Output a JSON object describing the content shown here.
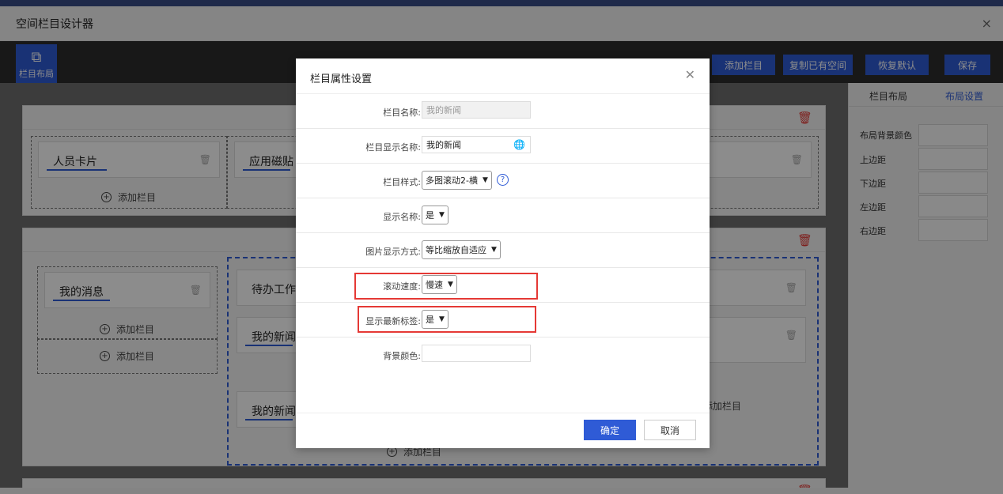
{
  "window": {
    "title": "空间栏目设计器",
    "close_icon": "×"
  },
  "toolbar": {
    "layout_button_label": "栏目布局",
    "add_column_label": "添加栏目",
    "copy_space_label": "复制已有空间",
    "restore_default_label": "恢复默认",
    "save_label": "保存"
  },
  "canvas": {
    "cards": {
      "personnel_card": "人员卡片",
      "app_tiles": "应用磁贴",
      "my_messages": "我的消息",
      "todo_work": "待办工作",
      "my_news_1": "我的新闻",
      "my_news_2": "我的新闻"
    },
    "add_column_text": "添加栏目"
  },
  "right_panel": {
    "tabs": [
      "栏目布局",
      "布局设置"
    ],
    "fields": [
      "布局背景颜色",
      "上边距",
      "下边距",
      "左边距",
      "右边距"
    ]
  },
  "modal": {
    "title": "栏目属性设置",
    "rows": [
      {
        "label": "栏目名称:",
        "value": "我的新闻",
        "kind": "input-disabled"
      },
      {
        "label": "栏目显示名称:",
        "value": "我的新闻",
        "kind": "input-globe"
      },
      {
        "label": "栏目样式:",
        "value": "多图滚动2-横",
        "kind": "select-help"
      },
      {
        "label": "显示名称:",
        "value": "是",
        "kind": "select"
      },
      {
        "label": "图片显示方式:",
        "value": "等比缩放自适应",
        "kind": "select"
      },
      {
        "label": "滚动速度:",
        "value": "慢速",
        "kind": "select"
      },
      {
        "label": "显示最新标签:",
        "value": "是",
        "kind": "select"
      },
      {
        "label": "背景颜色:",
        "value": "",
        "kind": "input"
      }
    ],
    "help_glyph": "?",
    "ok_label": "确定",
    "cancel_label": "取消"
  },
  "colors": {
    "primary": "#2f5bd6",
    "highlight": "#e53935",
    "delete": "#e53935"
  }
}
